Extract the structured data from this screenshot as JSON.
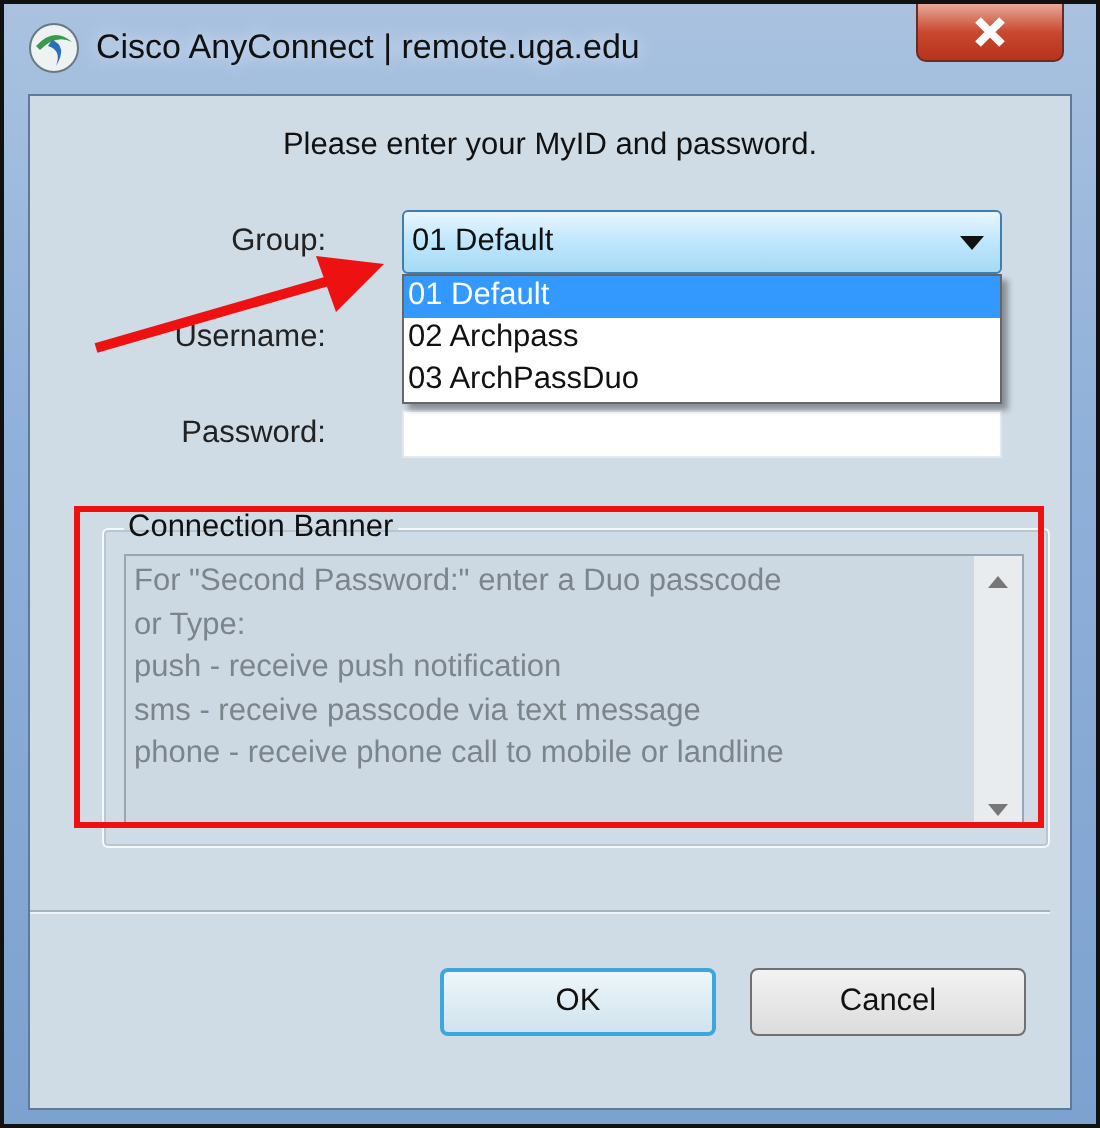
{
  "window": {
    "title": "Cisco AnyConnect | remote.uga.edu"
  },
  "prompt": "Please enter your MyID and password.",
  "fields": [
    {
      "label": "Group:",
      "kind": "dropdown",
      "value": "01 Default",
      "expanded": true,
      "options": [
        {
          "label": "01 Default",
          "selected": true
        },
        {
          "label": "02 Archpass",
          "selected": false
        },
        {
          "label": "03 ArchPassDuo",
          "selected": false
        }
      ]
    },
    {
      "label": "Username:",
      "kind": "text"
    },
    {
      "label": "Password:",
      "kind": "password"
    }
  ],
  "banner": {
    "title": "Connection Banner",
    "lines": [
      "For \"Second Password:\" enter a Duo passcode",
      "or Type:",
      "push - receive push notification",
      "sms - receive passcode via text message",
      "phone - receive phone call to mobile or landline"
    ]
  },
  "buttons": [
    {
      "label": "OK",
      "default": true
    },
    {
      "label": "Cancel",
      "default": false
    }
  ]
}
